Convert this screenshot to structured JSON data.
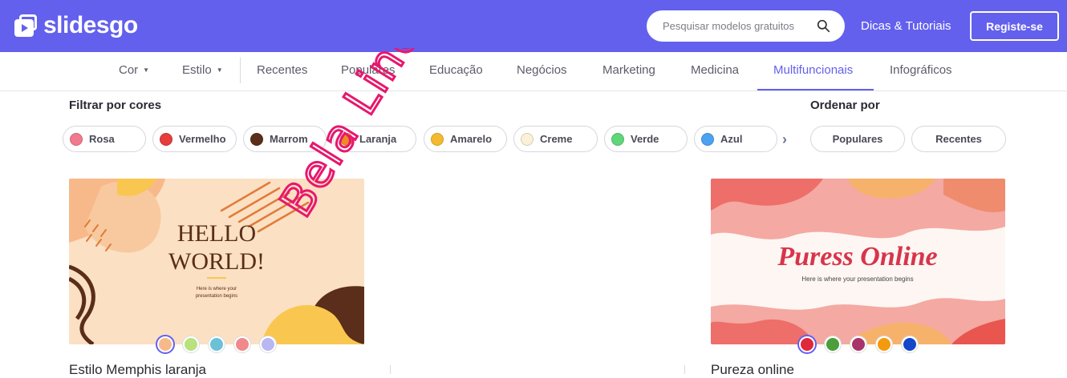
{
  "header": {
    "logo_text": "slidesgo",
    "search_placeholder": "Pesquisar modelos gratuitos",
    "tips_link": "Dicas & Tutoriais",
    "register_label": "Registe-se",
    "brand_color": "#6360ee"
  },
  "nav": {
    "color_label": "Cor",
    "style_label": "Estilo",
    "items": [
      "Recentes",
      "Populares",
      "Educação",
      "Negócios",
      "Marketing",
      "Medicina",
      "Multifuncionais",
      "Infográficos"
    ],
    "active": "Multifuncionais"
  },
  "filters": {
    "title": "Filtrar por cores",
    "colors": [
      {
        "label": "Rosa",
        "color": "#f07a8e"
      },
      {
        "label": "Vermelho",
        "color": "#e63d3d"
      },
      {
        "label": "Marrom",
        "color": "#5a2e1a"
      },
      {
        "label": "Laranja",
        "color": "#f08a24"
      },
      {
        "label": "Amarelo",
        "color": "#f4b92e"
      },
      {
        "label": "Creme",
        "color": "#fbf1d8"
      },
      {
        "label": "Verde",
        "color": "#5ed67a"
      },
      {
        "label": "Azul",
        "color": "#4aa3f0"
      }
    ]
  },
  "sort": {
    "title": "Ordenar por",
    "options": [
      "Populares",
      "Recentes"
    ]
  },
  "cards": [
    {
      "title": "Estilo Memphis laranja",
      "thumb_heading_1": "HELLO",
      "thumb_heading_2": "WORLD!",
      "thumb_sub_1": "Here is where your",
      "thumb_sub_2": "presentation begins",
      "swatches": [
        "#f8b98a",
        "#b7e27e",
        "#6cc1d6",
        "#f08a8a",
        "#b9b7f2"
      ]
    },
    {
      "title": "Pureza online",
      "thumb_heading": "Puress Online",
      "thumb_sub": "Here is where your presentation begins",
      "swatches": [
        "#e0283a",
        "#4a9e3c",
        "#a8336a",
        "#f39a0f",
        "#1448c9"
      ]
    }
  ],
  "overlay_text": "Bela Linda"
}
